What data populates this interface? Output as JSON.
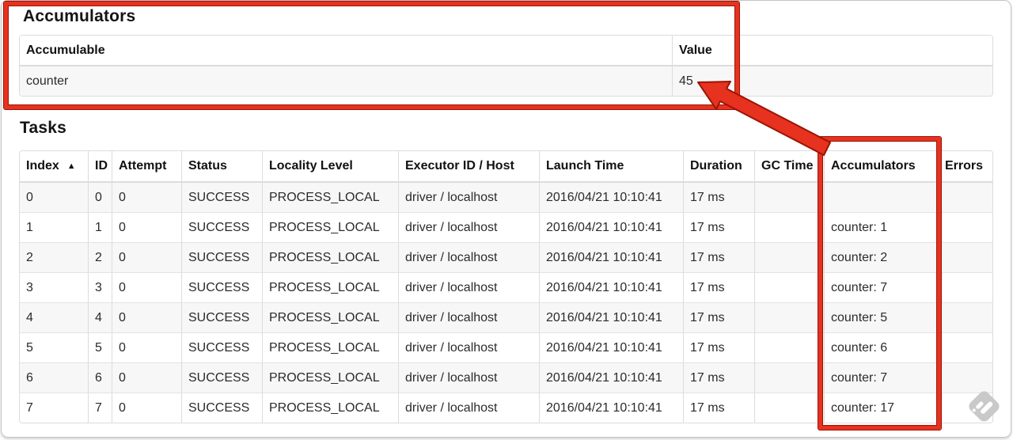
{
  "accumulators_section": {
    "title": "Accumulators",
    "table": {
      "headers": [
        "Accumulable",
        "Value"
      ],
      "rows": [
        [
          "counter",
          "45"
        ]
      ]
    }
  },
  "tasks_section": {
    "title": "Tasks",
    "table": {
      "sort_icon": "▲",
      "headers": [
        "Index",
        "ID",
        "Attempt",
        "Status",
        "Locality Level",
        "Executor ID / Host",
        "Launch Time",
        "Duration",
        "GC Time",
        "Accumulators",
        "Errors"
      ],
      "column_keys": [
        "index",
        "id",
        "attempt",
        "status",
        "locality-level",
        "executor-id-host",
        "launch-time",
        "duration",
        "gc-time",
        "accumulators",
        "errors"
      ],
      "rows": [
        [
          "0",
          "0",
          "0",
          "SUCCESS",
          "PROCESS_LOCAL",
          "driver / localhost",
          "2016/04/21 10:10:41",
          "17 ms",
          "",
          "",
          ""
        ],
        [
          "1",
          "1",
          "0",
          "SUCCESS",
          "PROCESS_LOCAL",
          "driver / localhost",
          "2016/04/21 10:10:41",
          "17 ms",
          "",
          "counter: 1",
          ""
        ],
        [
          "2",
          "2",
          "0",
          "SUCCESS",
          "PROCESS_LOCAL",
          "driver / localhost",
          "2016/04/21 10:10:41",
          "17 ms",
          "",
          "counter: 2",
          ""
        ],
        [
          "3",
          "3",
          "0",
          "SUCCESS",
          "PROCESS_LOCAL",
          "driver / localhost",
          "2016/04/21 10:10:41",
          "17 ms",
          "",
          "counter: 7",
          ""
        ],
        [
          "4",
          "4",
          "0",
          "SUCCESS",
          "PROCESS_LOCAL",
          "driver / localhost",
          "2016/04/21 10:10:41",
          "17 ms",
          "",
          "counter: 5",
          ""
        ],
        [
          "5",
          "5",
          "0",
          "SUCCESS",
          "PROCESS_LOCAL",
          "driver / localhost",
          "2016/04/21 10:10:41",
          "17 ms",
          "",
          "counter: 6",
          ""
        ],
        [
          "6",
          "6",
          "0",
          "SUCCESS",
          "PROCESS_LOCAL",
          "driver / localhost",
          "2016/04/21 10:10:41",
          "17 ms",
          "",
          "counter: 7",
          ""
        ],
        [
          "7",
          "7",
          "0",
          "SUCCESS",
          "PROCESS_LOCAL",
          "driver / localhost",
          "2016/04/21 10:10:41",
          "17 ms",
          "",
          "counter: 17",
          ""
        ]
      ]
    }
  },
  "annotations": {
    "highlight_color": "#e6321f",
    "highlight_outline_color": "#9b1405"
  }
}
